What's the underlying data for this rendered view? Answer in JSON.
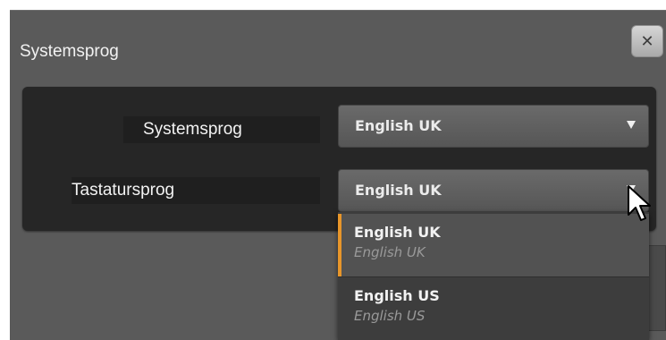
{
  "dialog": {
    "title": "Systemsprog",
    "close_icon": "close-icon"
  },
  "form": {
    "system_language_label": "Systemsprog",
    "system_language_value": "English UK",
    "keyboard_language_label": "Tastatursprog",
    "keyboard_language_value": "English UK"
  },
  "dropdown": {
    "options": [
      {
        "label": "English UK",
        "sublabel": "English UK",
        "selected": true
      },
      {
        "label": "English US",
        "sublabel": "English US",
        "selected": false
      }
    ],
    "accent_color": "#e8962a"
  },
  "icons": {
    "close": "close-icon",
    "chevron": "chevron-down-icon",
    "cursor": "mouse-pointer-icon"
  }
}
